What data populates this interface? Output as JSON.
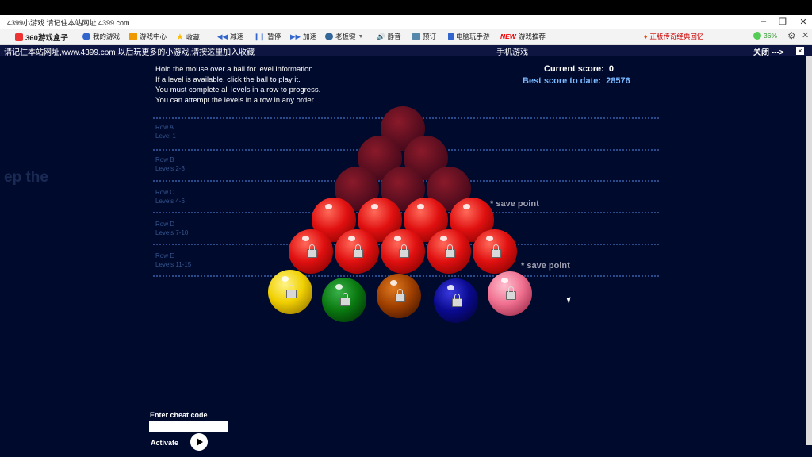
{
  "window": {
    "title": "4399小游戏 请记住本站网址 4399.com"
  },
  "toolbar": {
    "items": [
      {
        "label": "360游戏盒子",
        "icon": "gamepad-icon"
      },
      {
        "label": "我的游戏",
        "icon": "user-icon"
      },
      {
        "label": "游戏中心",
        "icon": "home-icon"
      },
      {
        "label": "收藏",
        "icon": "star-icon"
      },
      {
        "label": "减速",
        "icon": "rewind-icon"
      },
      {
        "label": "暂停",
        "icon": "pause-icon"
      },
      {
        "label": "加速",
        "icon": "fast-forward-icon"
      },
      {
        "label": "老板键",
        "icon": "boss-key-icon"
      },
      {
        "label": "静音",
        "icon": "speaker-icon"
      },
      {
        "label": "预订",
        "icon": "bookmark-icon"
      },
      {
        "label": "电脑玩手游",
        "icon": "phone-icon"
      },
      {
        "label": "NEW",
        "icon": "new-badge"
      },
      {
        "label": "游戏推荐",
        "icon": ""
      }
    ],
    "promo": "正版传奇经典回忆",
    "battery": "36%"
  },
  "notice": {
    "left": "请记住本站网址,www.4399.com 以后玩更多的小游戏,请按这里加入收藏",
    "center": "手机游戏",
    "close": "关闭 --->",
    "close_x": "×"
  },
  "game": {
    "instructions": [
      "Hold the mouse over a ball for level information.",
      "If a level is available, click the ball to play it.",
      "You must complete all levels in a row to progress.",
      "You can attempt the levels in a row in any order."
    ],
    "current_score_label": "Current score:",
    "current_score": "0",
    "best_score_label": "Best score to date:",
    "best_score": "28576",
    "rows": [
      {
        "name": "Row A",
        "levels": "Level 1"
      },
      {
        "name": "Row B",
        "levels": "Levels 2-3"
      },
      {
        "name": "Row C",
        "levels": "Levels 4-6"
      },
      {
        "name": "Row D",
        "levels": "Levels 7-10"
      },
      {
        "name": "Row E",
        "levels": "Levels 11-15"
      }
    ],
    "save_point": "* save point",
    "ghost_text": "ep the",
    "cheat_label": "Enter cheat code",
    "activate_label": "Activate",
    "colors": {
      "red": "#e01010",
      "yellow": "#f0d000",
      "green": "#0a7a10",
      "brown": "#a04000",
      "blue": "#0a0a90",
      "pink": "#f07090",
      "bg": "#000a2c"
    }
  }
}
